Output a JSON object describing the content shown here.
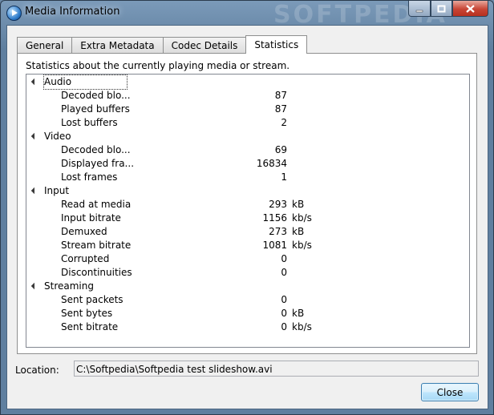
{
  "window": {
    "title": "Media Information",
    "watermark": "SOFTPEDIA"
  },
  "tabs": [
    {
      "label": "General",
      "active": false
    },
    {
      "label": "Extra Metadata",
      "active": false
    },
    {
      "label": "Codec Details",
      "active": false
    },
    {
      "label": "Statistics",
      "active": true
    }
  ],
  "statistics": {
    "description": "Statistics about the currently playing media or stream.",
    "groups": [
      {
        "name": "Audio",
        "items": [
          {
            "label": "Decoded blo...",
            "value": "87",
            "unit": ""
          },
          {
            "label": "Played buffers",
            "value": "87",
            "unit": ""
          },
          {
            "label": "Lost buffers",
            "value": "2",
            "unit": ""
          }
        ]
      },
      {
        "name": "Video",
        "items": [
          {
            "label": "Decoded blo...",
            "value": "69",
            "unit": ""
          },
          {
            "label": "Displayed fra...",
            "value": "16834",
            "unit": ""
          },
          {
            "label": "Lost frames",
            "value": "1",
            "unit": ""
          }
        ]
      },
      {
        "name": "Input",
        "items": [
          {
            "label": "Read at media",
            "value": "293",
            "unit": "kB"
          },
          {
            "label": "Input bitrate",
            "value": "1156",
            "unit": "kb/s"
          },
          {
            "label": "Demuxed",
            "value": "273",
            "unit": "kB"
          },
          {
            "label": "Stream bitrate",
            "value": "1081",
            "unit": "kb/s"
          },
          {
            "label": "Corrupted",
            "value": "0",
            "unit": ""
          },
          {
            "label": "Discontinuities",
            "value": "0",
            "unit": ""
          }
        ]
      },
      {
        "name": "Streaming",
        "items": [
          {
            "label": "Sent packets",
            "value": "0",
            "unit": ""
          },
          {
            "label": "Sent bytes",
            "value": "0",
            "unit": "kB"
          },
          {
            "label": "Sent bitrate",
            "value": "0",
            "unit": "kb/s"
          }
        ]
      }
    ]
  },
  "location": {
    "label": "Location:",
    "value": "C:\\Softpedia\\Softpedia test slideshow.avi"
  },
  "buttons": {
    "close_label": "Close"
  }
}
